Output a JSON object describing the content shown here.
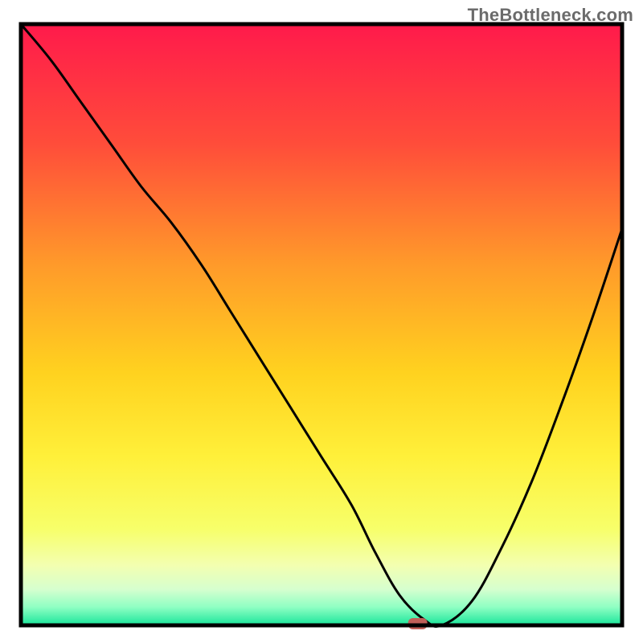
{
  "watermark": "TheBottleneck.com",
  "chart_data": {
    "type": "line",
    "title": "",
    "xlabel": "",
    "ylabel": "",
    "xlim": [
      0,
      100
    ],
    "ylim": [
      0,
      100
    ],
    "x": [
      0,
      5,
      10,
      15,
      20,
      25,
      30,
      35,
      40,
      45,
      50,
      55,
      59,
      63,
      67,
      70,
      75,
      80,
      85,
      90,
      95,
      100
    ],
    "values": [
      100,
      94,
      87,
      80,
      73,
      67,
      60,
      52,
      44,
      36,
      28,
      20,
      12,
      5,
      1,
      0,
      4,
      13,
      24,
      37,
      51,
      66
    ],
    "marker": {
      "x": 66,
      "y": 0
    },
    "curve_color": "#000000",
    "frame_color": "#000000",
    "gradient_stops": [
      {
        "offset": 0.0,
        "color": "#ff1a4b"
      },
      {
        "offset": 0.2,
        "color": "#ff4d3a"
      },
      {
        "offset": 0.4,
        "color": "#ff9a2a"
      },
      {
        "offset": 0.58,
        "color": "#ffd21f"
      },
      {
        "offset": 0.72,
        "color": "#fff03a"
      },
      {
        "offset": 0.84,
        "color": "#f7ff6a"
      },
      {
        "offset": 0.9,
        "color": "#f3ffb0"
      },
      {
        "offset": 0.94,
        "color": "#d6ffcf"
      },
      {
        "offset": 0.97,
        "color": "#8effc3"
      },
      {
        "offset": 1.0,
        "color": "#18e59a"
      }
    ]
  }
}
